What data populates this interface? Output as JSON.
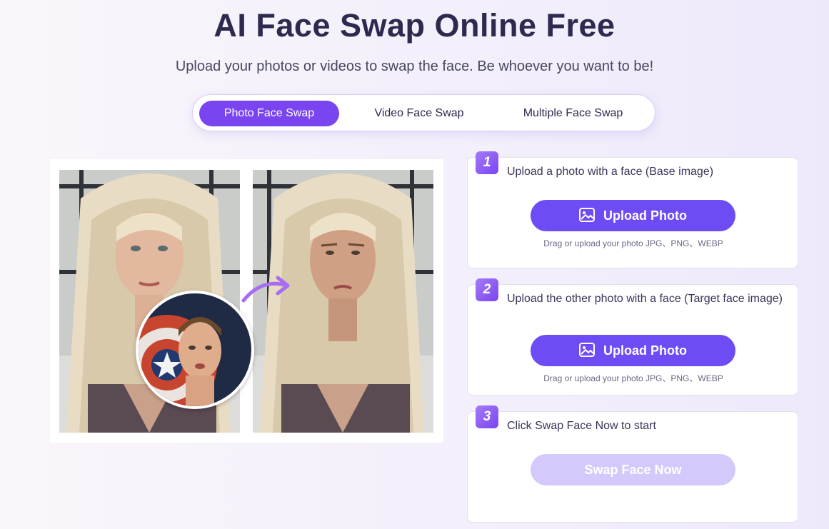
{
  "header": {
    "title": "AI Face Swap Online Free",
    "subtitle": "Upload your photos or videos to swap the face. Be whoever you want to be!"
  },
  "tabs": [
    {
      "label": "Photo Face Swap",
      "active": true
    },
    {
      "label": "Video Face Swap",
      "active": false
    },
    {
      "label": "Multiple Face Swap",
      "active": false
    }
  ],
  "steps": [
    {
      "number": "1",
      "text": "Upload a photo with a face (Base image)",
      "button_label": "Upload Photo",
      "hint": "Drag or upload your photo JPG、PNG、WEBP"
    },
    {
      "number": "2",
      "text": "Upload the other photo with a face (Target face image)",
      "button_label": "Upload Photo",
      "hint": "Drag or upload your photo JPG、PNG、WEBP"
    },
    {
      "number": "3",
      "text": "Click Swap Face Now to start",
      "button_label": "Swap Face Now"
    }
  ],
  "colors": {
    "accent": "#7a45f0",
    "button": "#6d4cf6",
    "button_disabled": "#d5c9fb"
  }
}
